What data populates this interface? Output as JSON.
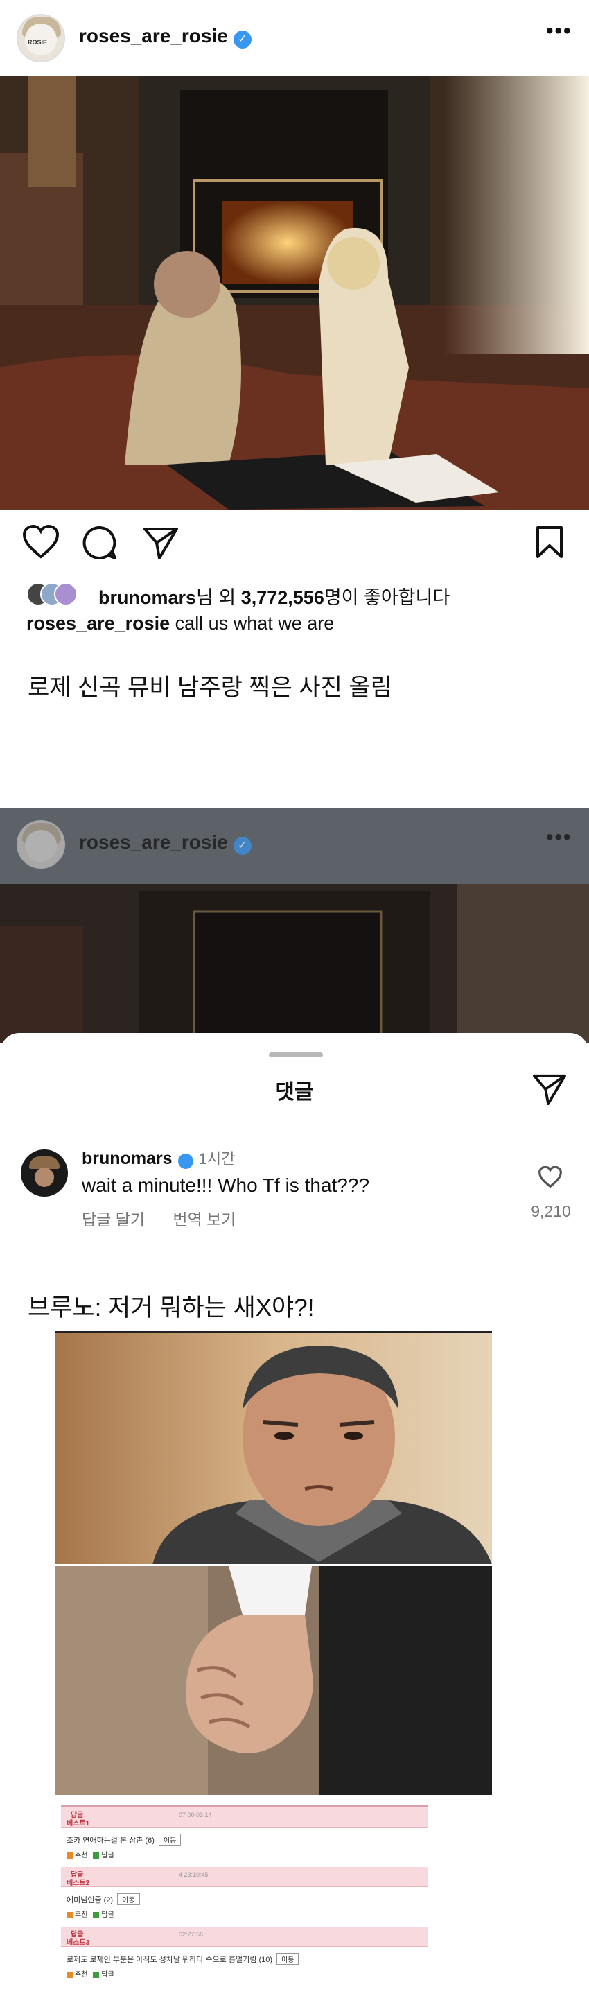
{
  "post": {
    "username": "roses_are_rosie",
    "avatar_caption": "ROSIE",
    "likes_prefix_user": "brunomars",
    "likes_mid": "님 외 ",
    "likes_count": "3,772,556",
    "likes_suffix": "명이 좋아합니다",
    "caption_user": "roses_are_rosie",
    "caption_text": "call us what we are",
    "more_icon": "more-icon",
    "verified_icon": "verified-badge-icon"
  },
  "writer_note": "로제 신곡 뮤비 남주랑 찍은 사진 올림",
  "second_post": {
    "username": "roses_are_rosie"
  },
  "comments_sheet": {
    "title": "댓글",
    "comment": {
      "user": "brunomars",
      "time": "1시간",
      "text": "wait a minute!!! Who Tf is that???",
      "reply": "답글 달기",
      "translate": "번역 보기",
      "like_count": "9,210"
    }
  },
  "meme_caption": "브루노: 저거 뭐하는 새X야?!",
  "forum": {
    "rows": [
      {
        "tag": "답글",
        "label": "베스트1",
        "time": "07 00:03:14",
        "text": "조카 연애하는걸 본 삼촌 (6)",
        "btn": "이동",
        "a": "추천",
        "b": "답글"
      },
      {
        "tag": "답글",
        "label": "베스트2",
        "time": "4 23:10:45",
        "text": "에미넴인줄 (2)",
        "btn": "이동",
        "a": "추천",
        "b": "답글"
      },
      {
        "tag": "답글",
        "label": "베스트3",
        "time": "02:27:56",
        "text": "로제도 로제인 부분은 아직도 성차날 뭐하다 속으로 흥얼거림 (10)",
        "btn": "이동",
        "a": "추천",
        "b": "답글"
      }
    ]
  },
  "colors": {
    "verified": "#3897f0",
    "overlay": "#5a5f66",
    "forum_pink": "#f7d9de",
    "forum_red": "#c0303a"
  }
}
